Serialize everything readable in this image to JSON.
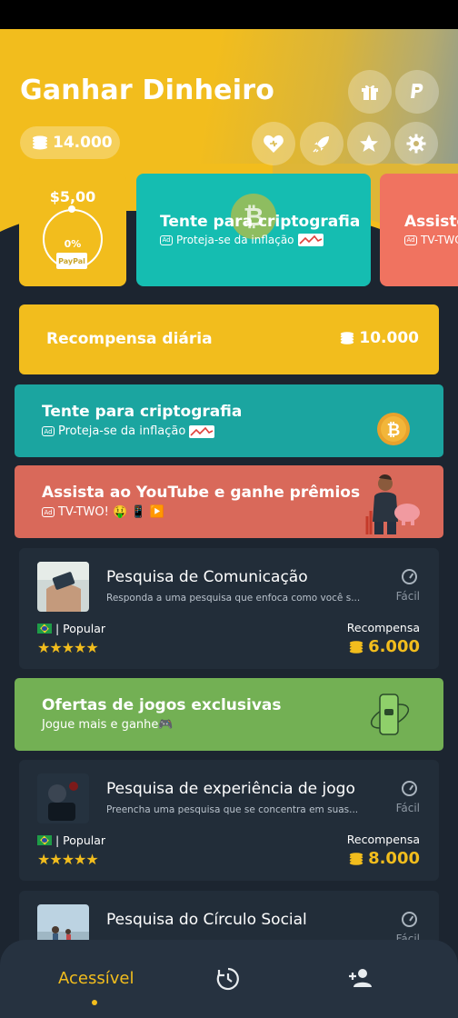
{
  "header": {
    "title": "Ganhar Dinheiro",
    "coins": "14.000",
    "icons": [
      "gift-icon",
      "paypal-icon",
      "heart-icon",
      "rocket-icon",
      "star-icon",
      "gear-icon"
    ]
  },
  "cards": {
    "paypal": {
      "amount": "$5,00",
      "progress": "0%",
      "progress_fraction": 0,
      "badge": "PayPal"
    },
    "crypto": {
      "title": "Tente para criptografia",
      "subtitle": "Proteja-se da inflação"
    },
    "youtube": {
      "title": "Assiste",
      "subtitle": "TV-TWO"
    }
  },
  "daily": {
    "label": "Recompensa diária",
    "value": "10.000"
  },
  "banners": [
    {
      "title": "Tente para criptografia",
      "subtitle": "Proteja-se da inflação",
      "color": "#1ba5a0"
    },
    {
      "title": "Assista ao YouTube e ganhe prêmios",
      "subtitle": "TV-TWO! 🤑 📱 ▶️",
      "color": "#d9695a"
    },
    {
      "title": "Ofertas de jogos exclusivas",
      "subtitle": "Jogue mais e ganhe🎮",
      "color": "#73b054"
    }
  ],
  "surveys": [
    {
      "title": "Pesquisa de Comunicação",
      "desc": "Responda a uma pesquisa que enfoca como você s...",
      "difficulty": "Fácil",
      "tag": "| Popular",
      "stars": "★★★★★",
      "reward_label": "Recompensa",
      "reward": "6.000"
    },
    {
      "title": "Pesquisa de experiência de jogo",
      "desc": "Preencha uma pesquisa que se concentra em suas...",
      "difficulty": "Fácil",
      "tag": "| Popular",
      "stars": "★★★★★",
      "reward_label": "Recompensa",
      "reward": "8.000"
    },
    {
      "title": "Pesquisa do Círculo Social",
      "desc": "",
      "difficulty": "Fácil",
      "tag": "",
      "stars": "",
      "reward_label": "",
      "reward": ""
    }
  ],
  "nav": {
    "active_label": "Acessível",
    "icons": [
      "history-icon",
      "add-person-icon"
    ]
  },
  "colors": {
    "accent": "#f2bd1d",
    "background": "#1c2530",
    "card": "#222d39",
    "teal": "#15bdb1",
    "coral": "#f07360"
  }
}
